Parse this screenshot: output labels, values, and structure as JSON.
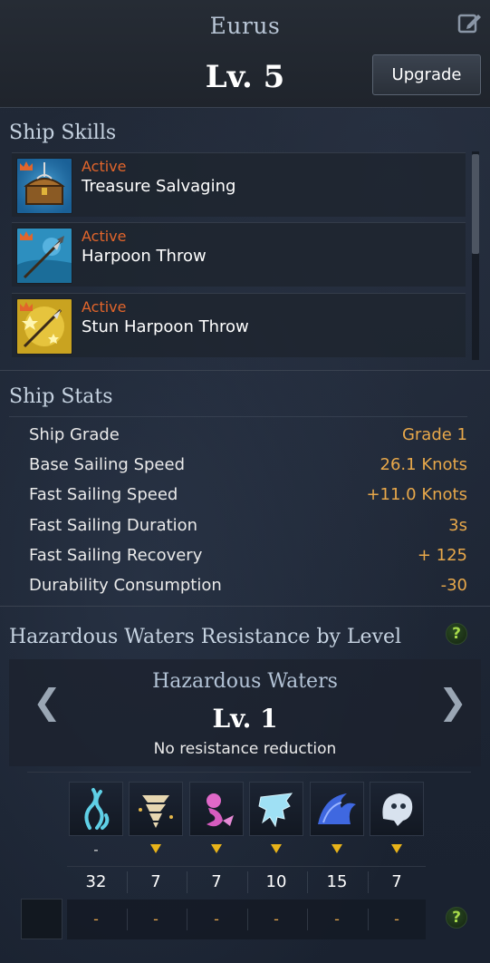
{
  "ship": {
    "name": "Eurus",
    "level": "Lv. 5",
    "upgrade_label": "Upgrade"
  },
  "icons": {
    "edit": "edit-pencil-icon",
    "crown": "crown-icon",
    "help": "help-question-icon"
  },
  "skills": {
    "title": "Ship Skills",
    "items": [
      {
        "type": "Active",
        "name": "Treasure Salvaging",
        "icon": "treasure-chest-icon"
      },
      {
        "type": "Active",
        "name": "Harpoon Throw",
        "icon": "harpoon-icon"
      },
      {
        "type": "Active",
        "name": "Stun Harpoon Throw",
        "icon": "stun-harpoon-icon"
      }
    ]
  },
  "stats": {
    "title": "Ship Stats",
    "items": [
      {
        "label": "Ship Grade",
        "value": "Grade 1"
      },
      {
        "label": "Base Sailing Speed",
        "value": "26.1 Knots"
      },
      {
        "label": "Fast Sailing Speed",
        "value": "+11.0 Knots"
      },
      {
        "label": "Fast Sailing Duration",
        "value": "3s"
      },
      {
        "label": "Fast Sailing Recovery",
        "value": "+ 125"
      },
      {
        "label": "Durability Consumption",
        "value": "-30"
      }
    ]
  },
  "hazard": {
    "section_title": "Hazardous Waters Resistance by Level",
    "panel_title": "Hazardous Waters",
    "level": "Lv. 1",
    "description": "No resistance reduction",
    "prev_glyph": "❮",
    "next_glyph": "❯",
    "help_glyph": "?",
    "types": [
      {
        "icon": "kelp-icon",
        "marker": "-",
        "value": "32",
        "resistance": "-"
      },
      {
        "icon": "whirlwind-icon",
        "marker": "down",
        "value": "7",
        "resistance": "-"
      },
      {
        "icon": "siren-icon",
        "marker": "down",
        "value": "7",
        "resistance": "-"
      },
      {
        "icon": "ice-icon",
        "marker": "down",
        "value": "10",
        "resistance": "-"
      },
      {
        "icon": "wave-icon",
        "marker": "down",
        "value": "15",
        "resistance": "-"
      },
      {
        "icon": "ghost-icon",
        "marker": "down",
        "value": "7",
        "resistance": "-"
      }
    ]
  },
  "colors": {
    "accent_orange": "#e2652b",
    "value_gold": "#e8a84a",
    "marker_yellow": "#e8b31a",
    "help_green": "#a6d94a"
  }
}
